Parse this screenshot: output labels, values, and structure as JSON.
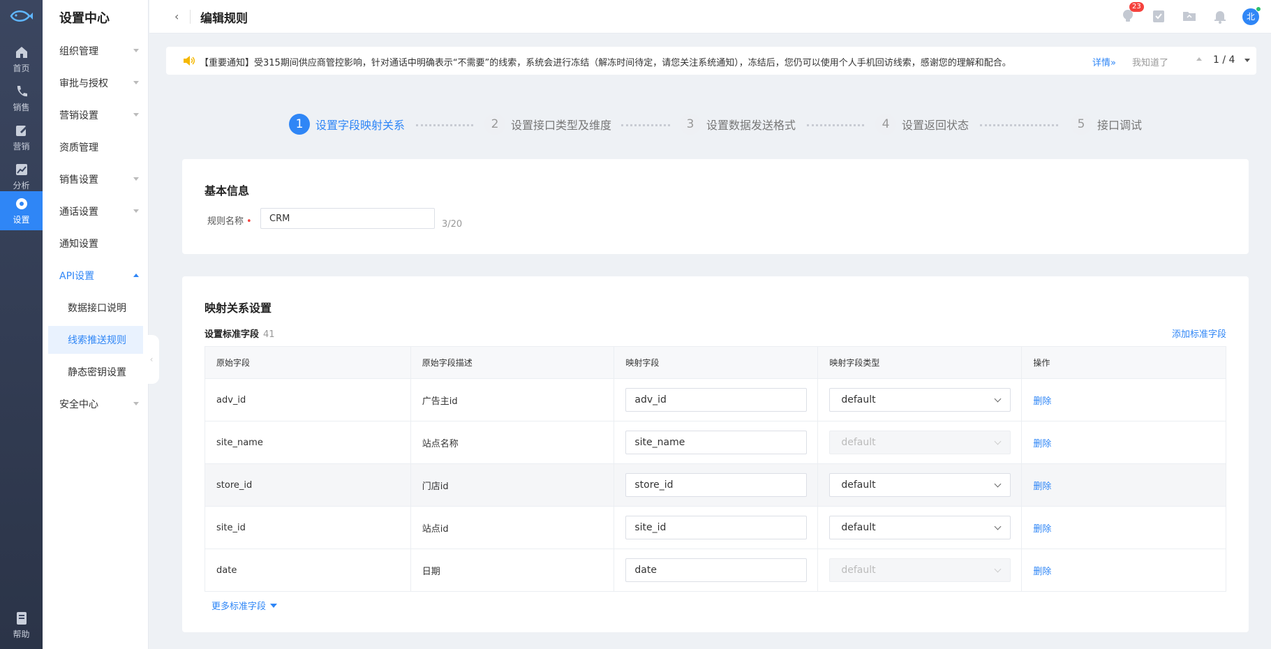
{
  "rail": {
    "items": [
      {
        "label": "首页",
        "icon": "home-icon"
      },
      {
        "label": "销售",
        "icon": "phone-icon"
      },
      {
        "label": "营销",
        "icon": "edit-icon"
      },
      {
        "label": "分析",
        "icon": "chart-icon"
      },
      {
        "label": "设置",
        "icon": "gear-icon",
        "active": true
      }
    ],
    "help_label": "帮助"
  },
  "sidebar": {
    "title": "设置中心",
    "items": [
      {
        "label": "组织管理"
      },
      {
        "label": "审批与授权"
      },
      {
        "label": "营销设置"
      },
      {
        "label": "资质管理"
      },
      {
        "label": "销售设置"
      },
      {
        "label": "通话设置"
      },
      {
        "label": "通知设置"
      },
      {
        "label": "API设置"
      },
      {
        "label": "数据接口说明"
      },
      {
        "label": "线索推送规则"
      },
      {
        "label": "静态密钥设置"
      },
      {
        "label": "安全中心"
      }
    ]
  },
  "header": {
    "title": "编辑规则",
    "notification_count": "23",
    "avatar_text": "北"
  },
  "notice": {
    "text": "【重要通知】受315期间供应商管控影响，针对通话中明确表示“不需要”的线索，系统会进行冻结（解冻时间待定，请您关注系统通知），冻结后，您仍可以使用个人手机回访线索，感谢您的理解和配合。",
    "more_label": "详情»",
    "dismiss_label": "我知道了",
    "page": "1 / 4"
  },
  "steps": [
    {
      "num": "1",
      "label": "设置字段映射关系"
    },
    {
      "num": "2",
      "label": "设置接口类型及维度"
    },
    {
      "num": "3",
      "label": "设置数据发送格式"
    },
    {
      "num": "4",
      "label": "设置返回状态"
    },
    {
      "num": "5",
      "label": "接口调试"
    }
  ],
  "basic": {
    "title": "基本信息",
    "name_label": "规则名称",
    "required_mark": "•",
    "name_value": "CRM",
    "counter": "3/20"
  },
  "mapping": {
    "title": "映射关系设置",
    "subtitle": "设置标准字段",
    "count": "41",
    "add_label": "添加标准字段",
    "columns": [
      "原始字段",
      "原始字段描述",
      "映射字段",
      "映射字段类型",
      "操作"
    ],
    "rows": [
      {
        "field": "adv_id",
        "desc": "广告主id",
        "mapped": "adv_id",
        "type": "default",
        "disabled": false,
        "action": "删除"
      },
      {
        "field": "site_name",
        "desc": "站点名称",
        "mapped": "site_name",
        "type": "default",
        "disabled": true,
        "action": "删除"
      },
      {
        "field": "store_id",
        "desc": "门店id",
        "mapped": "store_id",
        "type": "default",
        "disabled": false,
        "action": "删除"
      },
      {
        "field": "site_id",
        "desc": "站点id",
        "mapped": "site_id",
        "type": "default",
        "disabled": false,
        "action": "删除"
      },
      {
        "field": "date",
        "desc": "日期",
        "mapped": "date",
        "type": "default",
        "disabled": true,
        "action": "删除"
      }
    ],
    "more_label": "更多标准字段"
  },
  "colors": {
    "accent": "#2f86f6",
    "rail_bg": "#2b3448",
    "danger": "#f5423d"
  }
}
